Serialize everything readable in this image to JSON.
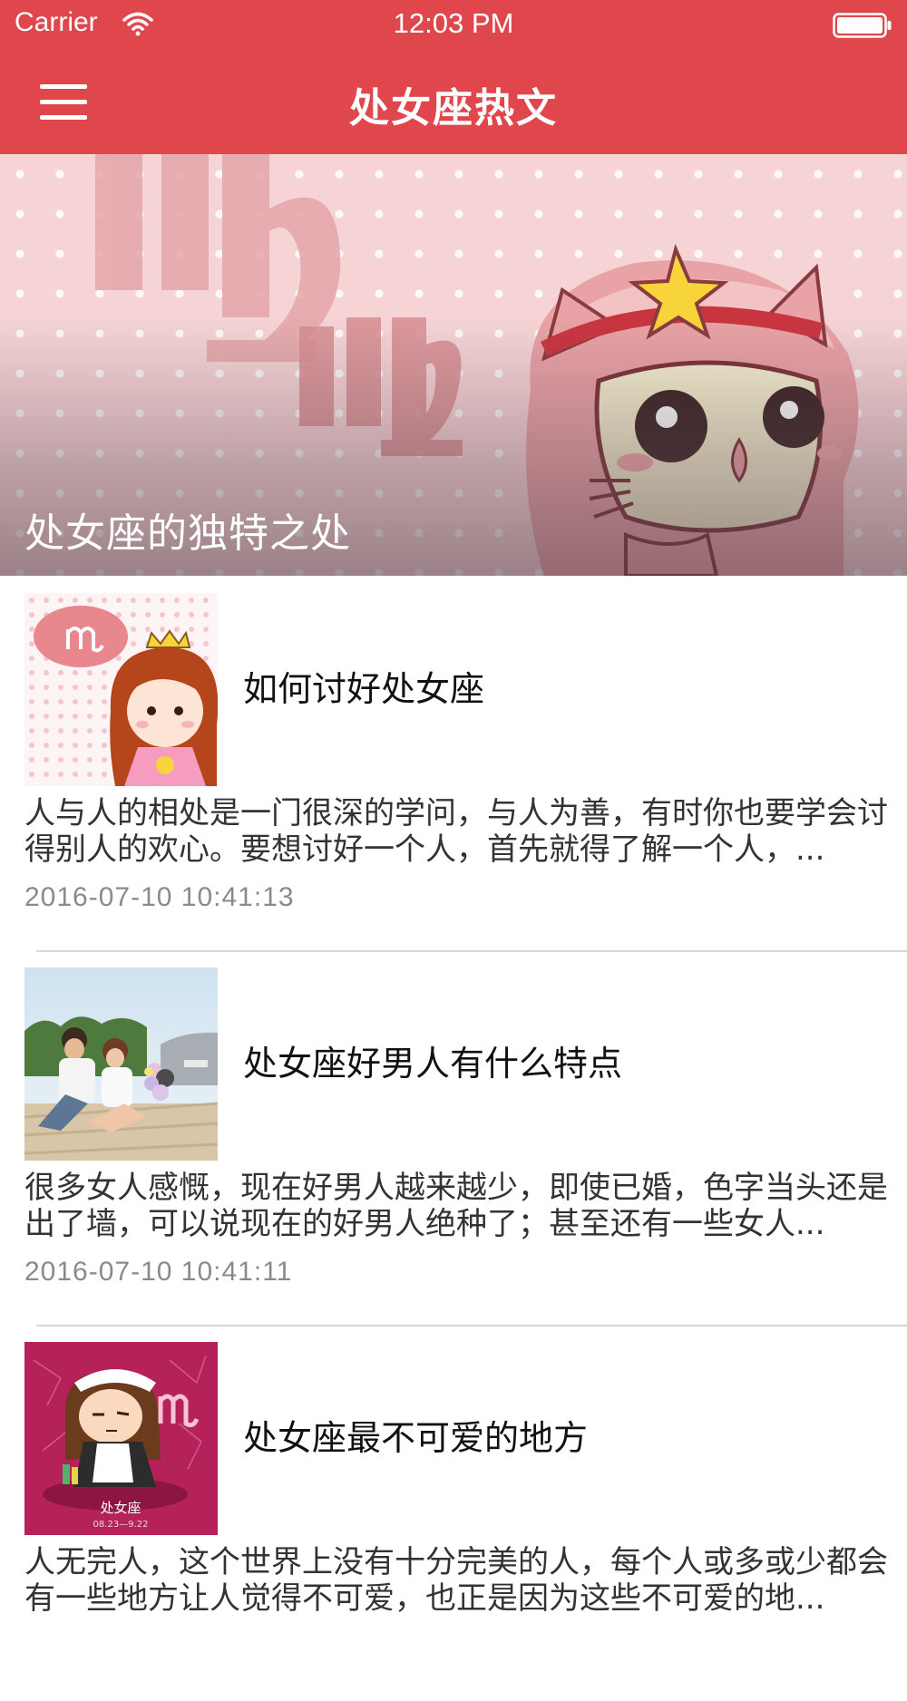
{
  "status_bar": {
    "carrier": "Carrier",
    "time": "12:03 PM",
    "wifi_icon": "wifi-icon",
    "battery_icon": "battery-icon"
  },
  "nav": {
    "title": "处女座热文",
    "menu_icon": "hamburger-menu-icon",
    "background_color": "#e0474d"
  },
  "hero": {
    "caption": "处女座的独特之处"
  },
  "articles": [
    {
      "title": "如何讨好处女座",
      "summary": "人与人的相处是一门很深的学问，与人为善，有时你也要学会讨得别人的欢心。要想讨好一个人，首先就得了解一个人，...",
      "date": "2016-07-10 10:41:13"
    },
    {
      "title": "处女座好男人有什么特点",
      "summary": "很多女人感慨，现在好男人越来越少，即使已婚，色字当头还是出了墙，可以说现在的好男人绝种了；甚至还有一些女人...",
      "date": "2016-07-10 10:41:11"
    },
    {
      "title": "处女座最不可爱的地方",
      "summary": "人无完人，这个世界上没有十分完美的人，每个人或多或少都会有一些地方让人觉得不可爱，也正是因为这些不可爱的地...",
      "thumb_text": "处女座",
      "thumb_dates": "08.23—9.22"
    }
  ]
}
